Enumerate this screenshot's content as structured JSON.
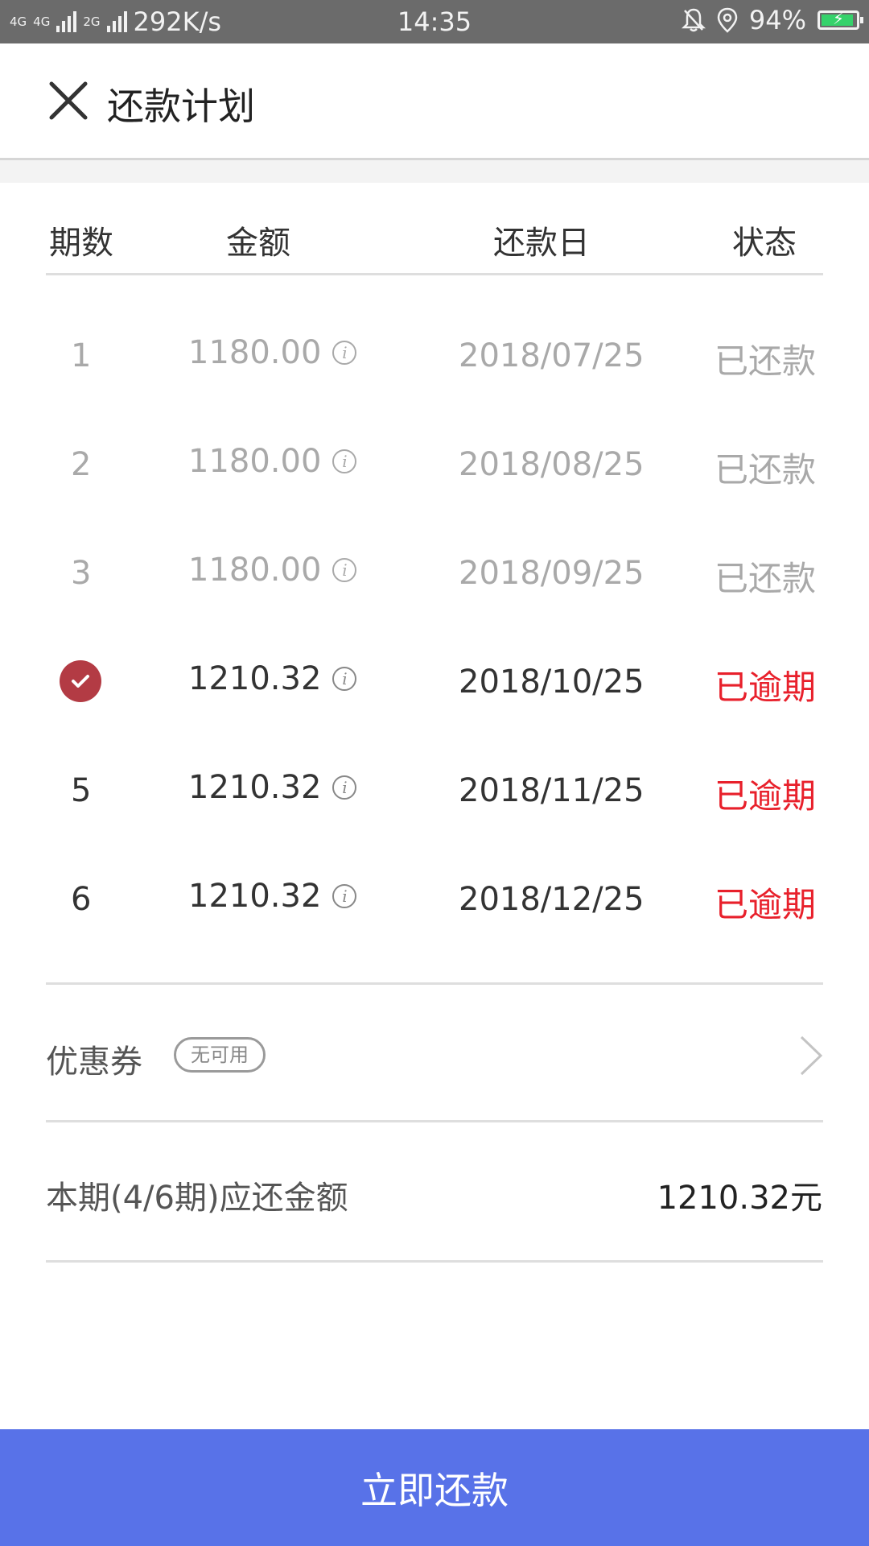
{
  "status_bar": {
    "network_top": "4G",
    "network_top2": "4G",
    "network_2g": "2G",
    "speed": "292K/s",
    "time": "14:35",
    "battery": "94%",
    "battery_level": 0.94,
    "icons": [
      "mute-icon",
      "location-icon",
      "battery-charging-icon"
    ]
  },
  "header": {
    "title": "还款计划",
    "close_icon": "close-icon"
  },
  "table": {
    "columns": [
      "期数",
      "金额",
      "还款日",
      "状态"
    ],
    "rows": [
      {
        "period": "1",
        "amount": "1180.00",
        "date": "2018/07/25",
        "status": "已还款",
        "state": "paid"
      },
      {
        "period": "2",
        "amount": "1180.00",
        "date": "2018/08/25",
        "status": "已还款",
        "state": "paid"
      },
      {
        "period": "3",
        "amount": "1180.00",
        "date": "2018/09/25",
        "status": "已还款",
        "state": "paid"
      },
      {
        "period": "",
        "amount": "1210.32",
        "date": "2018/10/25",
        "status": "已逾期",
        "state": "selected"
      },
      {
        "period": "5",
        "amount": "1210.32",
        "date": "2018/11/25",
        "status": "已逾期",
        "state": "overdue"
      },
      {
        "period": "6",
        "amount": "1210.32",
        "date": "2018/12/25",
        "status": "已逾期",
        "state": "overdue"
      }
    ]
  },
  "coupon": {
    "label": "优惠券",
    "badge": "无可用"
  },
  "due": {
    "label": "本期(4/6期)应还金额",
    "amount": "1210.32元"
  },
  "pay_button": {
    "label": "立即还款"
  },
  "colors": {
    "accent": "#5872e8",
    "overdue": "#e8202b",
    "check": "#b33b44"
  }
}
